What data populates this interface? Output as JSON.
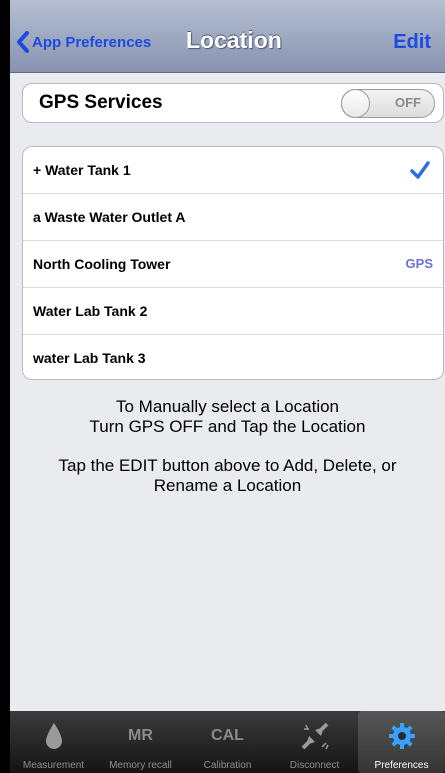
{
  "navbar": {
    "back_label": "App Preferences",
    "title": "Location",
    "edit_label": "Edit"
  },
  "gps": {
    "label": "GPS Services",
    "toggle_state": "OFF"
  },
  "locations": [
    {
      "label": "+ Water Tank 1",
      "selected": true
    },
    {
      "label": "a Waste Water Outlet A"
    },
    {
      "label": "North Cooling Tower",
      "tag": "GPS"
    },
    {
      "label": "Water Lab Tank 2"
    },
    {
      "label": "water Lab Tank 3"
    }
  ],
  "instructions": {
    "line1": "To Manually select a Location",
    "line2": "Turn GPS OFF and Tap the Location",
    "line3": "Tap the EDIT button above to Add, Delete, or",
    "line4": "Rename a Location"
  },
  "tabs": [
    {
      "label": "Measurement",
      "icon": "drop-icon"
    },
    {
      "label": "Memory recall",
      "icon_text": "MR"
    },
    {
      "label": "Calibration",
      "icon_text": "CAL"
    },
    {
      "label": "Disconnect",
      "icon": "disconnect-icon"
    },
    {
      "label": "Preferences",
      "icon": "gear-icon",
      "active": true
    }
  ],
  "colors": {
    "accent": "#1a4ce0",
    "gps_tag": "#6c6fd4",
    "checkmark": "#2f6ce0",
    "gear": "#3aa0ff"
  }
}
